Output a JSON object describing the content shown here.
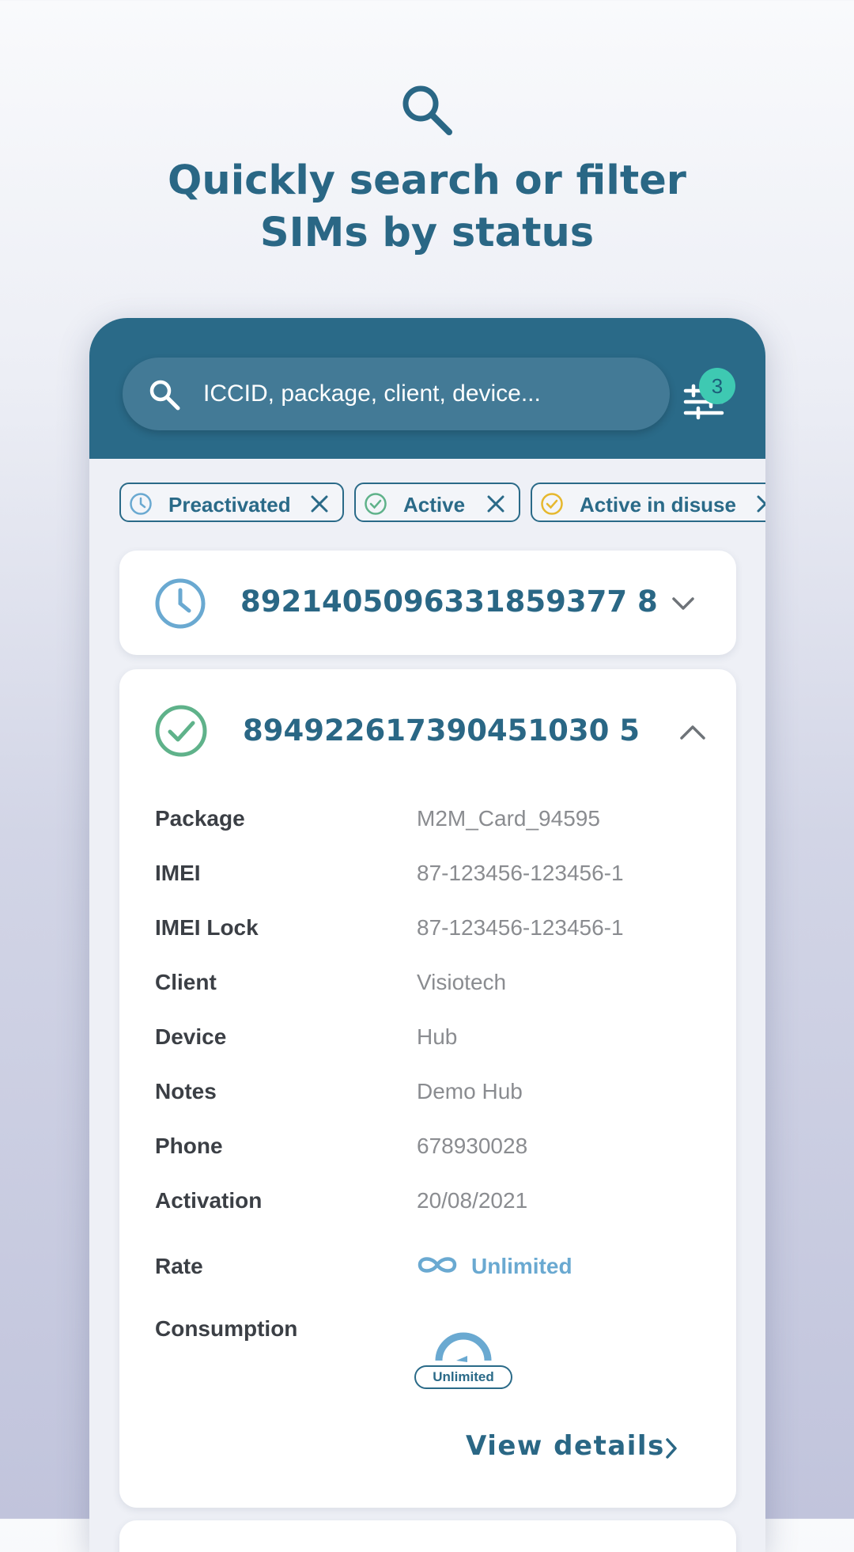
{
  "hero": {
    "title": "Quickly search or filter\nSIMs by status"
  },
  "search": {
    "placeholder": "ICCID, package, client, device..."
  },
  "filter": {
    "badge_count": "3"
  },
  "chips": [
    {
      "label": "Preactivated",
      "icon": "clock-icon",
      "color": "#6aa9d1"
    },
    {
      "label": "Active",
      "icon": "check-circle-icon",
      "color": "#5fb28a"
    },
    {
      "label": "Active in disuse",
      "icon": "check-circle-icon",
      "color": "#e6b82e"
    }
  ],
  "sims": [
    {
      "iccid": "8921405096331859377 8",
      "status": "preactivated"
    },
    {
      "iccid": "894922617390451030 5",
      "status": "active",
      "details": [
        {
          "label": "Package",
          "value": "M2M_Card_94595"
        },
        {
          "label": "IMEI",
          "value": "87-123456-123456-1"
        },
        {
          "label": "IMEI Lock",
          "value": "87-123456-123456-1"
        },
        {
          "label": "Client",
          "value": "Visiotech"
        },
        {
          "label": "Device",
          "value": "Hub"
        },
        {
          "label": "Notes",
          "value": "Demo Hub"
        },
        {
          "label": "Phone",
          "value": "678930028"
        },
        {
          "label": "Activation",
          "value": "20/08/2021"
        }
      ],
      "rate_label": "Rate",
      "rate_value": "Unlimited",
      "consumption_label": "Consumption",
      "consumption_value": "Unlimited",
      "view_details": "View details"
    }
  ],
  "colors": {
    "brand": "#2a6a88",
    "accent": "#3ec9b2",
    "active": "#5fb28a",
    "preactivated": "#6aa9d1",
    "disuse": "#e6b82e"
  }
}
